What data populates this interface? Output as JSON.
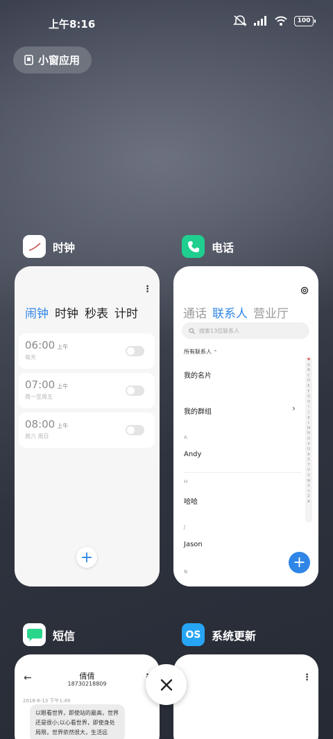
{
  "status_bar": {
    "time": "上午8:16",
    "battery": "100"
  },
  "floating_windows": {
    "label": "小窗应用"
  },
  "apps": {
    "clock": {
      "title": "时钟",
      "tabs": [
        "闹钟",
        "时钟",
        "秒表",
        "计时"
      ],
      "alarms": [
        {
          "time": "06:00",
          "ampm": "上午",
          "repeat": "每天"
        },
        {
          "time": "07:00",
          "ampm": "上午",
          "repeat": "周一至周五"
        },
        {
          "time": "08:00",
          "ampm": "上午",
          "repeat": "周六 周日"
        }
      ],
      "add": "+"
    },
    "phone": {
      "title": "电话",
      "tabs": [
        "通话",
        "联系人",
        "营业厅"
      ],
      "search_placeholder": "搜索13位联系人",
      "filter": "所有联系人",
      "my_card": "我的名片",
      "my_groups": "我的群组",
      "sections": [
        {
          "letter": "A",
          "name": "Andy"
        },
        {
          "letter": "H",
          "name": "哈哈"
        },
        {
          "letter": "J",
          "name": "Jason"
        },
        {
          "letter": "N",
          "name": ""
        }
      ],
      "alphabet": [
        "♥",
        "A",
        "B",
        "C",
        "D",
        "E",
        "F",
        "G",
        "H",
        "I",
        "J",
        "K",
        "L",
        "M",
        "N",
        "O",
        "P",
        "Q",
        "R",
        "S",
        "T",
        "U",
        "V",
        "W",
        "X",
        "Y",
        "Z",
        "#"
      ],
      "add": "+"
    },
    "sms": {
      "title": "短信",
      "contact_name": "倩倩",
      "contact_number": "18730218809",
      "date": "2016-6-13 下午1:49",
      "message": "以眼看世界，即使站的最高，世界还是很小;以心看世界，即使身处局限，世界依然很大，生活远"
    },
    "update": {
      "title": "系统更新",
      "icon_text": "OS"
    }
  },
  "colors": {
    "accent": "#2f86e6",
    "phone_icon": "#1fcf8f",
    "sms_icon": "#2ad68a",
    "update_icon": "#27a5f5"
  }
}
